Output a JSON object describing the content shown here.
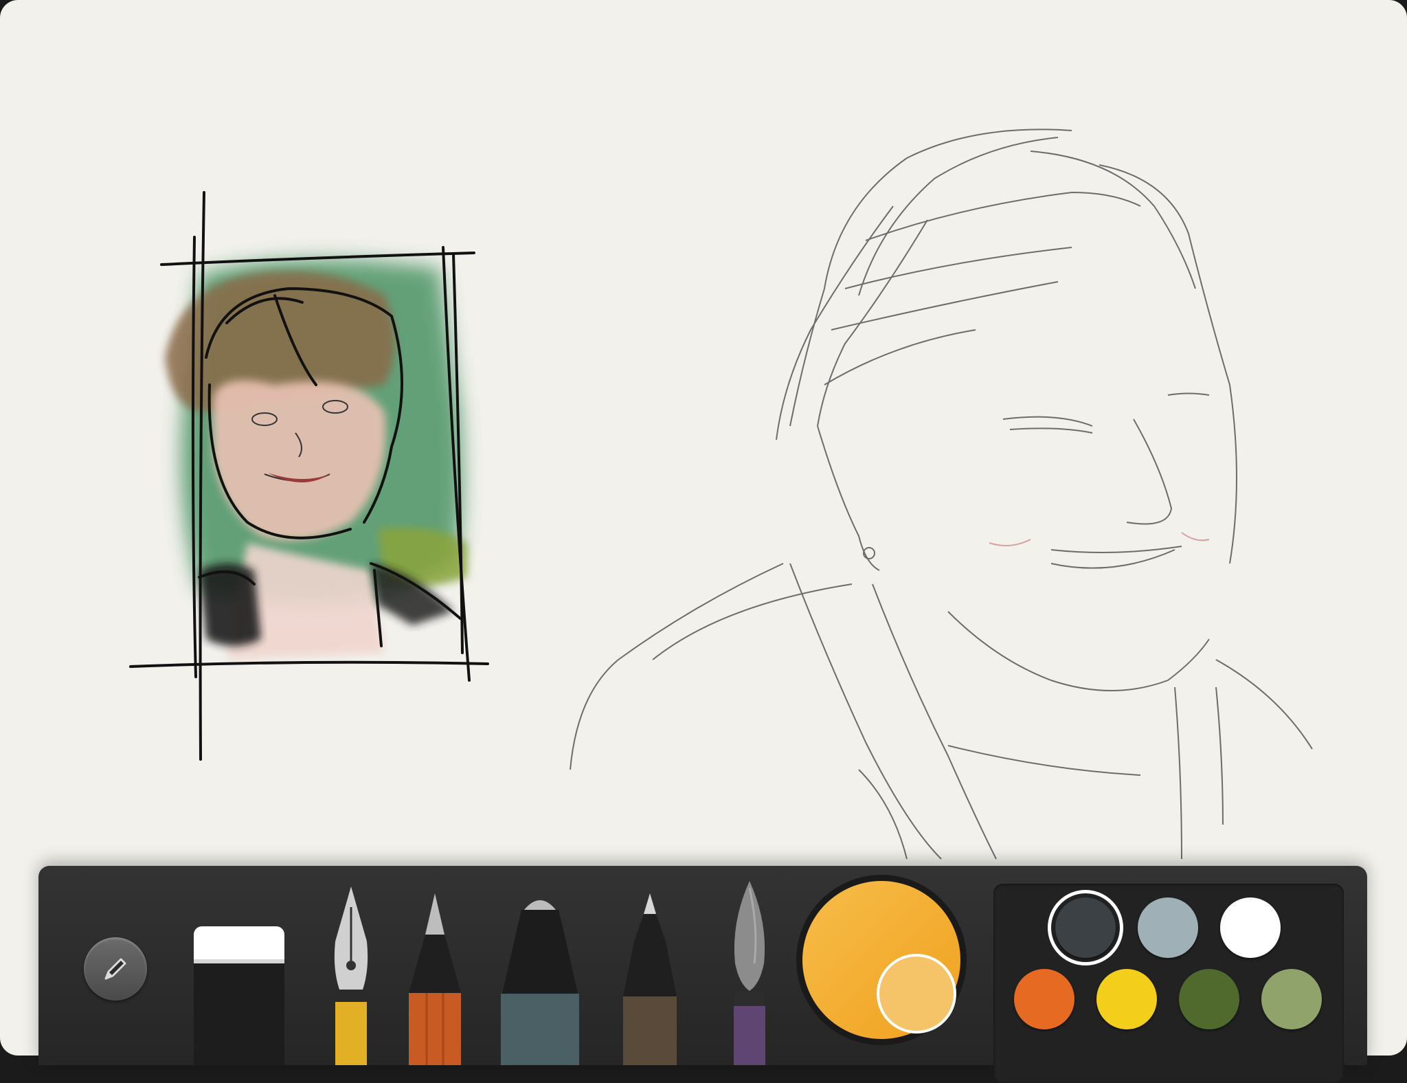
{
  "app": {
    "toolbar": {
      "tools": [
        {
          "id": "eraser",
          "icon": "eraser-icon"
        },
        {
          "id": "fountain-pen",
          "icon": "fountain-pen-icon"
        },
        {
          "id": "pencil",
          "icon": "pencil-icon"
        },
        {
          "id": "marker",
          "icon": "marker-icon"
        },
        {
          "id": "fine-pen",
          "icon": "fine-pen-icon"
        },
        {
          "id": "brush",
          "icon": "brush-icon"
        }
      ],
      "toggle_icon": "pencil-icon",
      "current_color": "#f4b43a"
    },
    "palette": {
      "swatches": [
        {
          "color": "#3b4144",
          "selected": true
        },
        {
          "color": "#9fb0b6",
          "selected": false
        },
        {
          "color": "#ffffff",
          "selected": false
        },
        {
          "color": "#e66a22",
          "selected": false
        },
        {
          "color": "#f3cf1c",
          "selected": false
        },
        {
          "color": "#4f6a2c",
          "selected": false
        },
        {
          "color": "#8fa36a",
          "selected": false
        }
      ]
    }
  }
}
